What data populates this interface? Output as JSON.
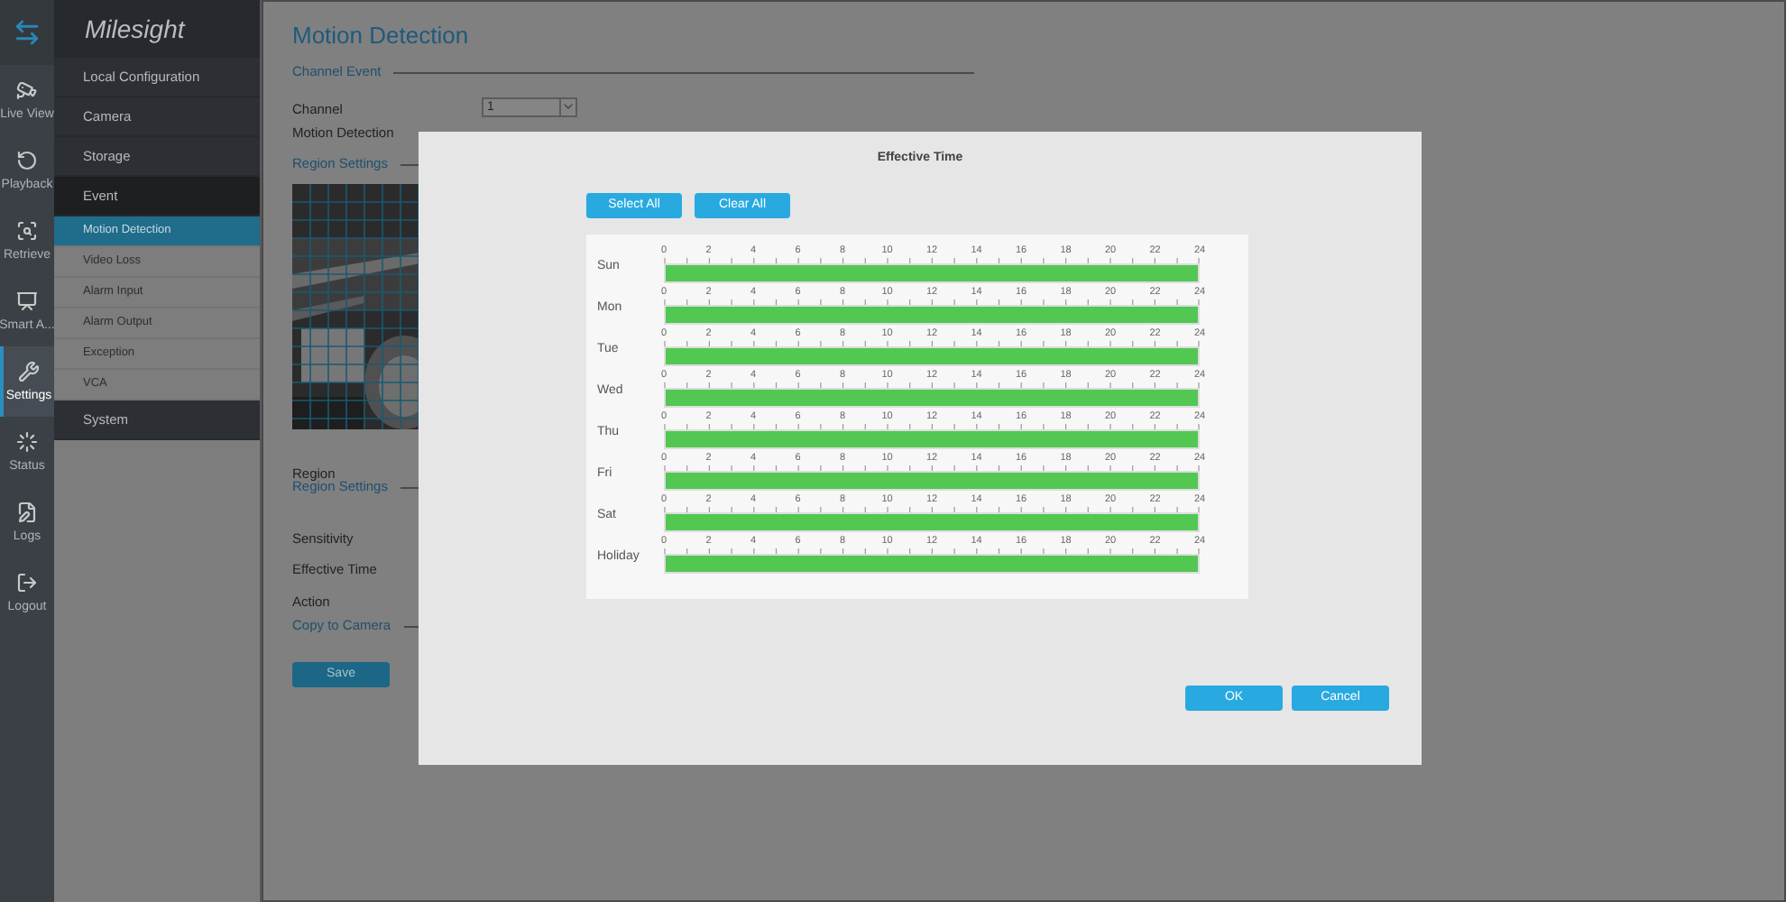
{
  "nav": [
    {
      "selected": false
    },
    {
      "label": "Live View",
      "selected": false
    },
    {
      "label": "Playback",
      "selected": false
    },
    {
      "label": "Retrieve",
      "selected": false
    },
    {
      "label": "Smart A...",
      "selected": false
    },
    {
      "label": "Settings",
      "selected": true
    },
    {
      "label": "Status",
      "selected": false
    },
    {
      "label": "Logs",
      "selected": false
    },
    {
      "label": "Logout",
      "selected": false
    }
  ],
  "logo": "Milesight",
  "menu": [
    {
      "label": "Local Configuration",
      "expanded": false
    },
    {
      "label": "Camera",
      "expanded": false
    },
    {
      "label": "Storage",
      "expanded": false
    },
    {
      "label": "Event",
      "expanded": true,
      "children": [
        {
          "label": "Motion Detection",
          "selected": true
        },
        {
          "label": "Video Loss",
          "selected": false
        },
        {
          "label": "Alarm Input",
          "selected": false
        },
        {
          "label": "Alarm Output",
          "selected": false
        },
        {
          "label": "Exception",
          "selected": false
        },
        {
          "label": "VCA",
          "selected": false
        }
      ]
    },
    {
      "label": "System",
      "expanded": false
    }
  ],
  "page": {
    "title": "Motion Detection",
    "section_channel": "Channel Event",
    "channel_label": "Channel",
    "channel_value": "1",
    "motion_label": "Motion Detection",
    "section_region": "Region Settings",
    "region_label": "Region",
    "section_region2": "Region Settings",
    "sensitivity_label": "Sensitivity",
    "effective_label": "Effective Time",
    "action_label": "Action",
    "section_copy": "Copy to Camera",
    "save": "Save"
  },
  "dialog": {
    "title": "Effective Time",
    "select_all": "Select All",
    "clear_all": "Clear All",
    "ok": "OK",
    "cancel": "Cancel",
    "days": [
      {
        "day": "Sun",
        "ticks": [
          "0",
          "2",
          "4",
          "6",
          "8",
          "10",
          "12",
          "14",
          "16",
          "18",
          "20",
          "22",
          "24"
        ],
        "level": 1
      },
      {
        "day": "Mon",
        "ticks": [
          "0",
          "2",
          "4",
          "6",
          "8",
          "10",
          "12",
          "14",
          "16",
          "18",
          "20",
          "22",
          "24"
        ],
        "level": 1
      },
      {
        "day": "Tue",
        "ticks": [
          "0",
          "2",
          "4",
          "6",
          "8",
          "10",
          "12",
          "14",
          "16",
          "18",
          "20",
          "22",
          "24"
        ],
        "level": 1
      },
      {
        "day": "Wed",
        "ticks": [
          "0",
          "2",
          "4",
          "6",
          "8",
          "10",
          "12",
          "14",
          "16",
          "18",
          "20",
          "22",
          "24"
        ],
        "level": 1
      },
      {
        "day": "Thu",
        "ticks": [
          "0",
          "2",
          "4",
          "6",
          "8",
          "10",
          "12",
          "14",
          "16",
          "18",
          "20",
          "22",
          "24"
        ],
        "level": 1
      },
      {
        "day": "Fri",
        "ticks": [
          "0",
          "2",
          "4",
          "6",
          "8",
          "10",
          "12",
          "14",
          "16",
          "18",
          "20",
          "22",
          "24"
        ],
        "level": 1
      },
      {
        "day": "Sat",
        "ticks": [
          "0",
          "2",
          "4",
          "6",
          "8",
          "10",
          "12",
          "14",
          "16",
          "18",
          "20",
          "22",
          "24"
        ],
        "level": 1
      },
      {
        "day": "Holiday",
        "ticks": [
          "0",
          "2",
          "4",
          "6",
          "8",
          "10",
          "12",
          "14",
          "16",
          "18",
          "20",
          "22",
          "24"
        ],
        "level": 1
      }
    ]
  }
}
